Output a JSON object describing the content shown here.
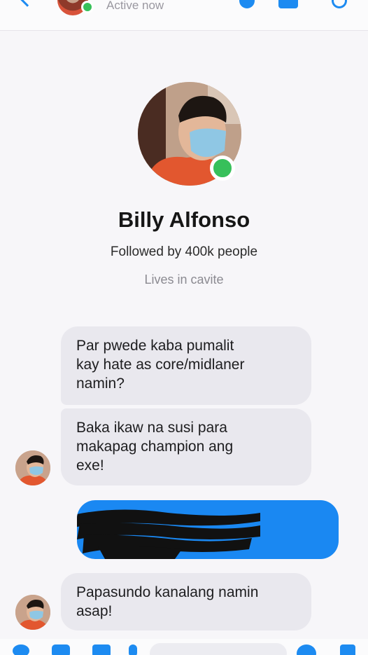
{
  "header": {
    "status": "Active now",
    "icons": [
      "back-icon",
      "phone-icon",
      "video-icon",
      "info-icon"
    ]
  },
  "profile": {
    "name": "Billy Alfonso",
    "followed": "Followed by 400k people",
    "lives": "Lives in cavite",
    "online": true
  },
  "messages": [
    {
      "text": "Par pwede kaba pumalit\nkay hate as core/midlaner\nnamin?"
    },
    {
      "text": "Baka ikaw na susi para\nmakapag champion ang\nexe!"
    },
    {
      "text": "Papasundo kanalang namin\nasap!"
    }
  ],
  "sent_message": {
    "redacted": true
  },
  "composer": {
    "icons": [
      "apps-icon",
      "camera-icon",
      "gallery-icon",
      "mic-icon",
      "emoji-icon",
      "like-icon"
    ]
  },
  "colors": {
    "accent": "#1a88f2",
    "incoming_bubble": "#e9e8ee",
    "online": "#37c05a"
  }
}
